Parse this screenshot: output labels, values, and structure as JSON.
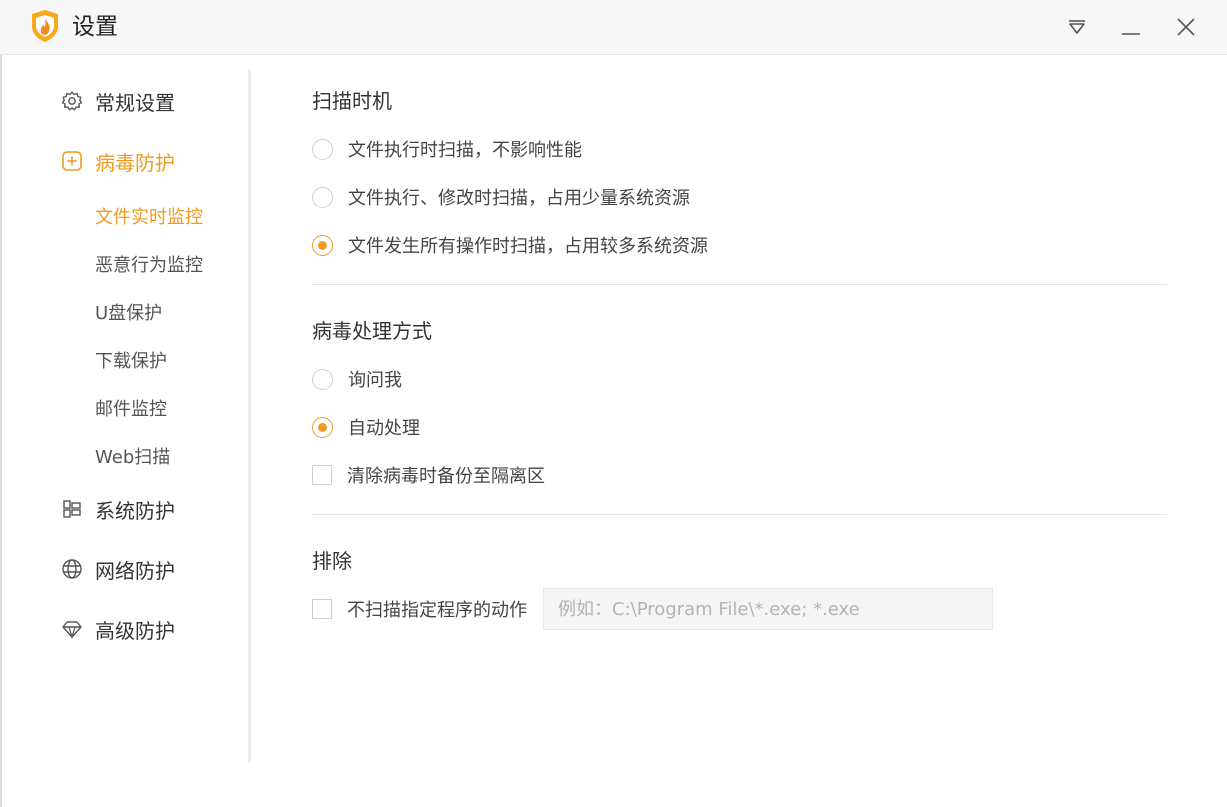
{
  "window": {
    "title": "设置",
    "accent_color": "#f29b21",
    "icons": [
      "fire-shield-logo-icon",
      "dropdown-menu-icon",
      "minimize-icon",
      "close-icon"
    ]
  },
  "sidebar": {
    "items": [
      {
        "label": "常规设置",
        "icon": "gear-icon",
        "active": false
      },
      {
        "label": "病毒防护",
        "icon": "plus-box-icon",
        "active": true
      },
      {
        "label": "系统防护",
        "icon": "blocks-icon",
        "active": false
      },
      {
        "label": "网络防护",
        "icon": "globe-icon",
        "active": false
      },
      {
        "label": "高级防护",
        "icon": "diamond-icon",
        "active": false
      }
    ],
    "subitems": [
      {
        "label": "文件实时监控",
        "active": true
      },
      {
        "label": "恶意行为监控",
        "active": false
      },
      {
        "label": "U盘保护",
        "active": false
      },
      {
        "label": "下载保护",
        "active": false
      },
      {
        "label": "邮件监控",
        "active": false
      },
      {
        "label": "Web扫描",
        "active": false
      }
    ]
  },
  "scan_timing": {
    "title": "扫描时机",
    "options": [
      {
        "label": "文件执行时扫描，不影响性能",
        "checked": false
      },
      {
        "label": "文件执行、修改时扫描，占用少量系统资源",
        "checked": false
      },
      {
        "label": "文件发生所有操作时扫描，占用较多系统资源",
        "checked": true
      }
    ]
  },
  "virus_handling": {
    "title": "病毒处理方式",
    "options": [
      {
        "label": "询问我",
        "checked": false
      },
      {
        "label": "自动处理",
        "checked": true
      }
    ],
    "backup": {
      "label": "清除病毒时备份至隔离区",
      "checked": false
    }
  },
  "exclusion": {
    "title": "排除",
    "checkbox": {
      "label": "不扫描指定程序的动作",
      "checked": false
    },
    "input_value": "",
    "input_placeholder": "例如：C:\\Program File\\*.exe; *.exe"
  }
}
